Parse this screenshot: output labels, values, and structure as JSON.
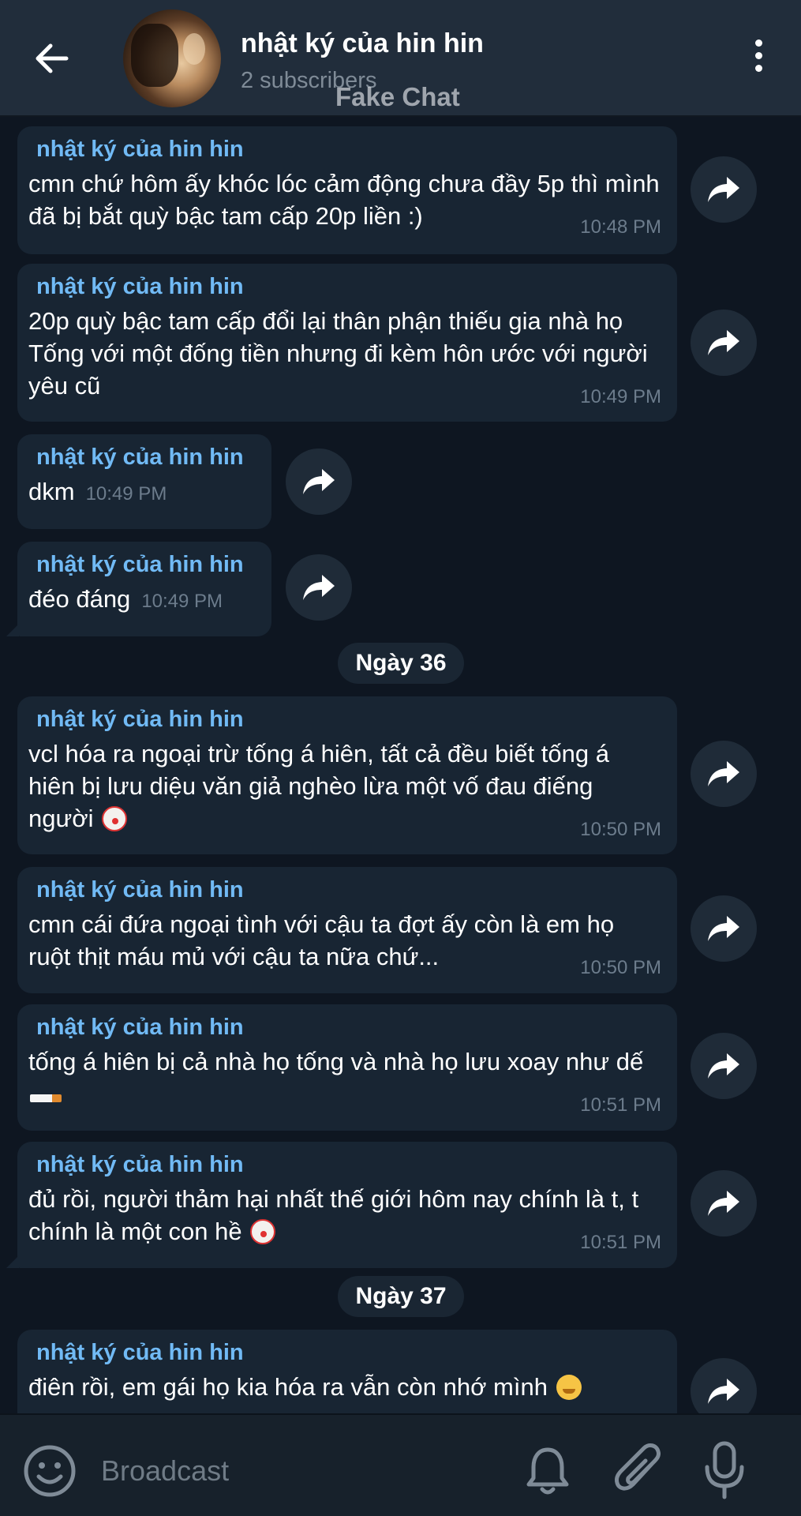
{
  "header": {
    "title": "nhật ký của hin hin",
    "subscribers": "2 subscribers",
    "watermark": "Fake Chat"
  },
  "messages": [
    {
      "sender": "nhật ký của hin hin",
      "text": "cmn chứ hôm ấy khóc lóc cảm động chưa đầy 5p thì mình đã bị bắt quỳ bậc tam cấp 20p liền :)",
      "time": "10:48 PM"
    },
    {
      "sender": "nhật ký của hin hin",
      "text": "20p quỳ bậc tam cấp đổi lại thân phận thiếu gia nhà họ Tống với một đống tiền nhưng đi kèm hôn ước với người yêu cũ",
      "time": "10:49 PM"
    },
    {
      "sender": "nhật ký của hin hin",
      "text": "dkm",
      "time": "10:49 PM"
    },
    {
      "sender": "nhật ký của hin hin",
      "text": "đéo đáng",
      "time": "10:49 PM"
    },
    {
      "sender": "nhật ký của hin hin",
      "text": "vcl hóa ra ngoại trừ tống á hiên, tất cả đều biết tống á hiên bị lưu diệu văn giả nghèo lừa một vố đau điếng người",
      "time": "10:50 PM",
      "emoji": "clown-face"
    },
    {
      "sender": "nhật ký của hin hin",
      "text": "cmn cái đứa ngoại tình với cậu ta đợt ấy còn là em họ ruột thịt máu mủ với cậu ta nữa chứ...",
      "time": "10:50 PM"
    },
    {
      "sender": "nhật ký của hin hin",
      "text": "tống á hiên bị cả nhà họ tống và nhà họ lưu xoay như dế",
      "time": "10:51 PM",
      "emoji": "cigarette"
    },
    {
      "sender": "nhật ký của hin hin",
      "text": "đủ rồi, người thảm hại nhất thế giới hôm nay chính là t, t chính là một con hề",
      "time": "10:51 PM",
      "emoji": "clown-face"
    },
    {
      "sender": "nhật ký của hin hin",
      "text": "điên rồi, em gái họ kia hóa ra vẫn còn nhớ mình",
      "emoji": "hugging-face"
    }
  ],
  "dates": [
    "Ngày 36",
    "Ngày 37"
  ],
  "composer": {
    "placeholder": "Broadcast"
  },
  "icons": {
    "back": "arrow-left-icon",
    "menu": "more-vert-icon",
    "forward": "share-arrow-icon",
    "emoji": "smile-icon",
    "bell": "bell-icon",
    "attach": "paperclip-icon",
    "mic": "microphone-icon"
  },
  "colors": {
    "background": "#0e1621",
    "header": "#212d3b",
    "bubble": "#182533",
    "sender": "#71baf5",
    "time": "#6c7c8c"
  }
}
